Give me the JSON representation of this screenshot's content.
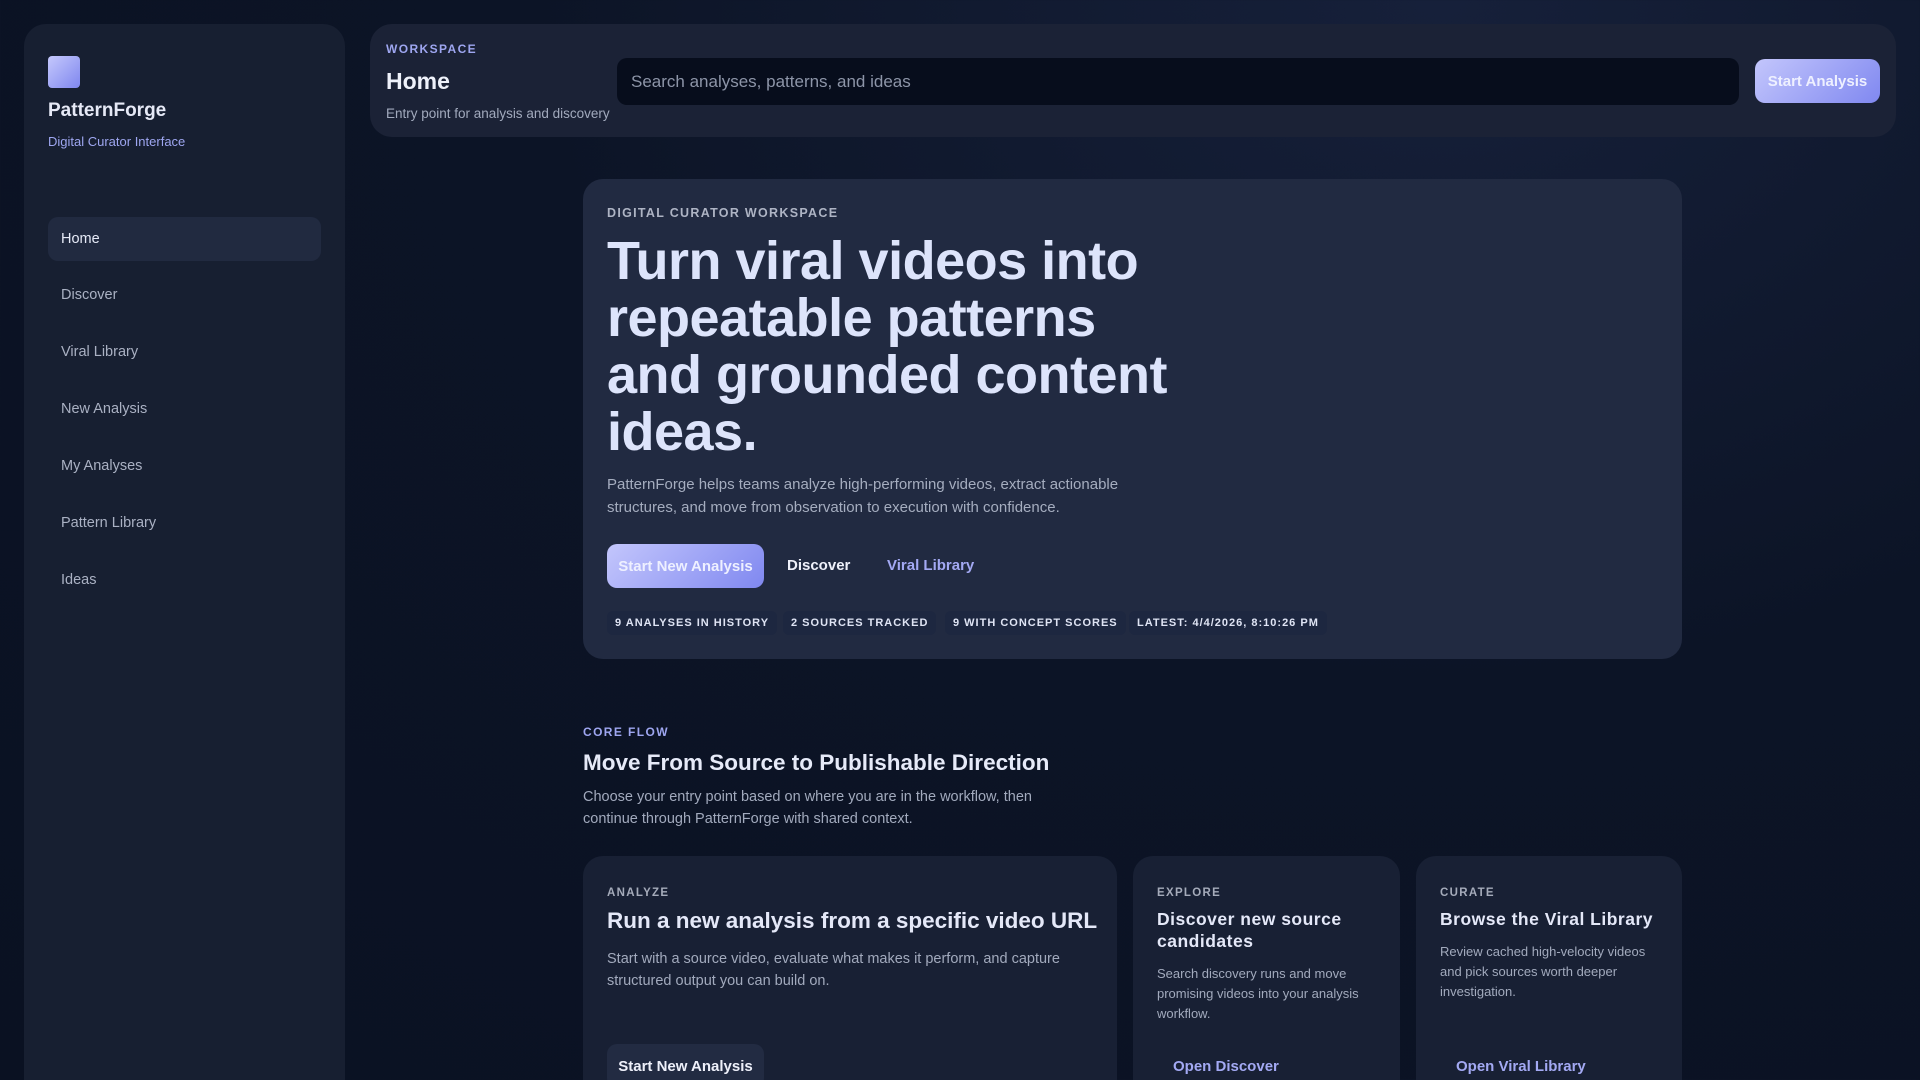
{
  "sidebar": {
    "brand": "PatternForge",
    "subtitle": "Digital Curator Interface",
    "items": [
      {
        "label": "Home"
      },
      {
        "label": "Discover"
      },
      {
        "label": "Viral Library"
      },
      {
        "label": "New Analysis"
      },
      {
        "label": "My Analyses"
      },
      {
        "label": "Pattern Library"
      },
      {
        "label": "Ideas"
      }
    ]
  },
  "topbar": {
    "eyebrow": "WORKSPACE",
    "title": "Home",
    "subtitle": "Entry point for analysis and discovery",
    "search_placeholder": "Search analyses, patterns, and ideas",
    "start_button": "Start Analysis"
  },
  "hero": {
    "eyebrow": "DIGITAL CURATOR WORKSPACE",
    "headline": "Turn viral videos into repeatable patterns and grounded content ideas.",
    "description": "PatternForge helps teams analyze high-performing videos, extract actionable structures, and move from observation to execution with confidence.",
    "primary_button": "Start New Analysis",
    "discover_button": "Discover",
    "library_button": "Viral Library",
    "stats": [
      "9 ANALYSES IN HISTORY",
      "2 SOURCES TRACKED",
      "9 WITH CONCEPT SCORES",
      "LATEST: 4/4/2026, 8:10:26 PM"
    ]
  },
  "core_flow": {
    "eyebrow": "CORE FLOW",
    "title": "Move From Source to Publishable Direction",
    "description": "Choose your entry point based on where you are in the workflow, then continue through PatternForge with shared context.",
    "cards": [
      {
        "label": "ANALYZE",
        "title": "Run a new analysis from a specific video URL",
        "description": "Start with a source video, evaluate what makes it perform, and capture structured output you can build on.",
        "action": "Start New Analysis"
      },
      {
        "label": "EXPLORE",
        "title": "Discover new source candidates",
        "description": "Search discovery runs and move promising videos into your analysis workflow.",
        "action": "Open Discover"
      },
      {
        "label": "CURATE",
        "title": "Browse the Viral Library",
        "description": "Review cached high-velocity videos and pick sources worth deeper investigation.",
        "action": "Open Viral Library"
      }
    ]
  }
}
